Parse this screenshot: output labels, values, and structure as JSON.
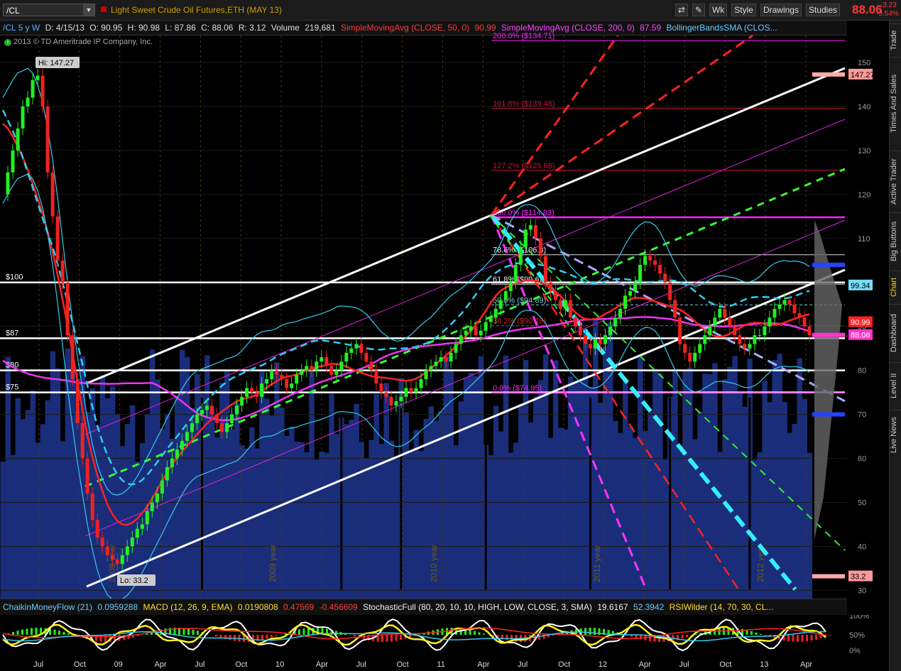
{
  "header": {
    "symbol": "/CL",
    "instrument": "Light Sweet Crude Oil Futures,ETH (MAY 13)",
    "toolbar": {
      "wk": "Wk",
      "style": "Style",
      "drawings": "Drawings",
      "studies": "Studies"
    },
    "last_price": "88.06",
    "change": "-3.23",
    "change_pct": "-3.54%"
  },
  "infobar": {
    "period": "/CL 5 y W",
    "date": "D: 4/15/13",
    "open": "O: 90.95",
    "high": "H: 90.98",
    "low": "L: 87.86",
    "close": "C: 88.06",
    "range": "R: 3.12",
    "volume_label": "Volume",
    "volume": "219,681",
    "sma50_label": "SimpleMovingAvg (CLOSE, 50, 0)",
    "sma50": "90.99",
    "sma200_label": "SimpleMovingAvg (CLOSE, 200, 0)",
    "sma200": "87.59",
    "boll_label": "BollingerBandsSMA (CLOS..."
  },
  "copyright": "2013 © TD Ameritrade IP Company, Inc.",
  "sidebar_tabs": [
    "Trade",
    "Times And Sales",
    "Active Trader",
    "Big Buttons",
    "Chart",
    "Dashboard",
    "Level II",
    "Live News"
  ],
  "subinfo": {
    "cmf_label": "ChaikinMoneyFlow (21)",
    "cmf": "0.0959288",
    "macd_label": "MACD (12, 26, 9, EMA)",
    "macd": "0.0190808",
    "macd2": "0.47569",
    "macd3": "-0.456609",
    "stoch_label": "StochasticFull (80, 20, 10, 10, HIGH, LOW, CLOSE, 3, SMA)",
    "stoch1": "19.6167",
    "stoch2": "52.3942",
    "rsi_label": "RSIWilder (14, 70, 30, CL..."
  },
  "colors": {
    "up": "#22ee22",
    "down": "#ee2222",
    "sma50": "#ff2222",
    "sma200": "#ee33ee",
    "boll": "#33ccee",
    "volume": "#1a2d7a",
    "white_line": "#ffffff"
  },
  "chart_data": {
    "type": "candlestick",
    "ylim": [
      27,
      155
    ],
    "y_ticks": [
      30,
      40,
      50,
      60,
      70,
      80,
      90,
      100,
      110,
      120,
      130,
      140,
      150
    ],
    "x_tick_labels": [
      "Jul",
      "Oct",
      "09",
      "Apr",
      "Jul",
      "Oct",
      "10",
      "Apr",
      "Jul",
      "Oct",
      "11",
      "Apr",
      "Jul",
      "Oct",
      "12",
      "Apr",
      "Jul",
      "Oct",
      "13",
      "Apr"
    ],
    "year_labels": [
      "2008 year",
      "2009 year",
      "2010 year",
      "2011 year",
      "2012 year"
    ],
    "annotations": {
      "hi": "Hi: 147.27",
      "lo": "Lo: 33.2"
    },
    "horizontal_levels": [
      {
        "label": "$100",
        "value": 100
      },
      {
        "label": "$87",
        "value": 87.3
      },
      {
        "label": "$80",
        "value": 80
      },
      {
        "label": "$75",
        "value": 75
      }
    ],
    "fib_levels": [
      {
        "label": "200.0%",
        "price": "($134.71)",
        "value": 155
      },
      {
        "label": "161.8%",
        "price": "($139.48)",
        "value": 139.6
      },
      {
        "label": "127.2%",
        "price": "($125.68)",
        "value": 125.5
      },
      {
        "label": "100.0%",
        "price": "($114.83)",
        "value": 114.8
      },
      {
        "label": "78.6%",
        "price": "($106.3)",
        "value": 106.3
      },
      {
        "label": "61.8%",
        "price": "($99.6)",
        "value": 99.6
      },
      {
        "label": "50.0%",
        "price": "($94.89)",
        "value": 94.9
      },
      {
        "label": "38.2%",
        "price": "($90.18)",
        "value": 90.2
      },
      {
        "label": "0.0%",
        "price": "($74.95)",
        "value": 74.95
      }
    ],
    "price_tags": [
      {
        "label": "147.27",
        "value": 147.27,
        "color": "#ff9999"
      },
      {
        "label": "99.34",
        "value": 99.34,
        "color": "#77ddff"
      },
      {
        "label": "90.99",
        "value": 90.99,
        "color": "#ff2222"
      },
      {
        "label": "88.06",
        "value": 88.06,
        "color": "#ff33cc"
      },
      {
        "label": "33.2",
        "value": 33.2,
        "color": "#ff9999"
      }
    ],
    "close_series": [
      120,
      125,
      130,
      135,
      140,
      142,
      146,
      147,
      140,
      125,
      115,
      105,
      100,
      88,
      78,
      68,
      60,
      52,
      46,
      42,
      40,
      38,
      37,
      36,
      38,
      40,
      42,
      44,
      45,
      48,
      50,
      52,
      55,
      58,
      60,
      62,
      64,
      66,
      68,
      70,
      71,
      72,
      70,
      68,
      66,
      68,
      70,
      72,
      74,
      76,
      75,
      74,
      77,
      78,
      80,
      79,
      78,
      76,
      77,
      79,
      80,
      81,
      80,
      82,
      83,
      81,
      79,
      80,
      82,
      84,
      85,
      86,
      84,
      82,
      80,
      77,
      75,
      74,
      72,
      73,
      74,
      76,
      75,
      76,
      78,
      80,
      81,
      82,
      83,
      82,
      84,
      86,
      88,
      89,
      90,
      88,
      89,
      91,
      92,
      94,
      96,
      98,
      100,
      104,
      108,
      112,
      113,
      110,
      106,
      100,
      98,
      96,
      94,
      96,
      92,
      90,
      88,
      86,
      85,
      87,
      86,
      88,
      90,
      92,
      94,
      97,
      98,
      100,
      104,
      106,
      105,
      104,
      102,
      100,
      96,
      92,
      86,
      84,
      82,
      84,
      86,
      88,
      90,
      92,
      94,
      92,
      90,
      88,
      86,
      85,
      86,
      88,
      88,
      90,
      92,
      94,
      95,
      96,
      95,
      93,
      92,
      90,
      88
    ]
  }
}
